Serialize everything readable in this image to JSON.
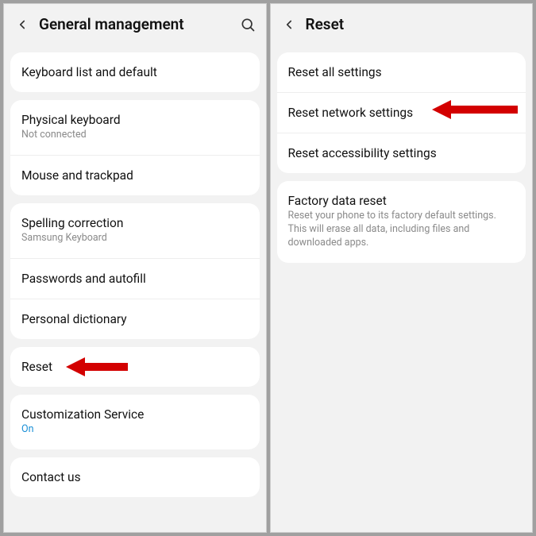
{
  "left": {
    "title": "General management",
    "groups": [
      {
        "items": [
          {
            "title": "Keyboard list and default"
          }
        ]
      },
      {
        "items": [
          {
            "title": "Physical keyboard",
            "sub": "Not connected"
          },
          {
            "title": "Mouse and trackpad"
          }
        ]
      },
      {
        "items": [
          {
            "title": "Spelling correction",
            "sub": "Samsung Keyboard"
          },
          {
            "title": "Passwords and autofill"
          },
          {
            "title": "Personal dictionary"
          }
        ]
      },
      {
        "items": [
          {
            "title": "Reset",
            "arrow": true
          }
        ]
      },
      {
        "items": [
          {
            "title": "Customization Service",
            "sub": "On",
            "subBlue": true
          }
        ]
      },
      {
        "items": [
          {
            "title": "Contact us"
          }
        ]
      }
    ]
  },
  "right": {
    "title": "Reset",
    "groups": [
      {
        "items": [
          {
            "title": "Reset all settings"
          },
          {
            "title": "Reset network settings",
            "arrow": true
          },
          {
            "title": "Reset accessibility settings"
          }
        ]
      },
      {
        "items": [
          {
            "title": "Factory data reset",
            "sub": "Reset your phone to its factory default settings. This will erase all data, including files and downloaded apps."
          }
        ]
      }
    ]
  }
}
